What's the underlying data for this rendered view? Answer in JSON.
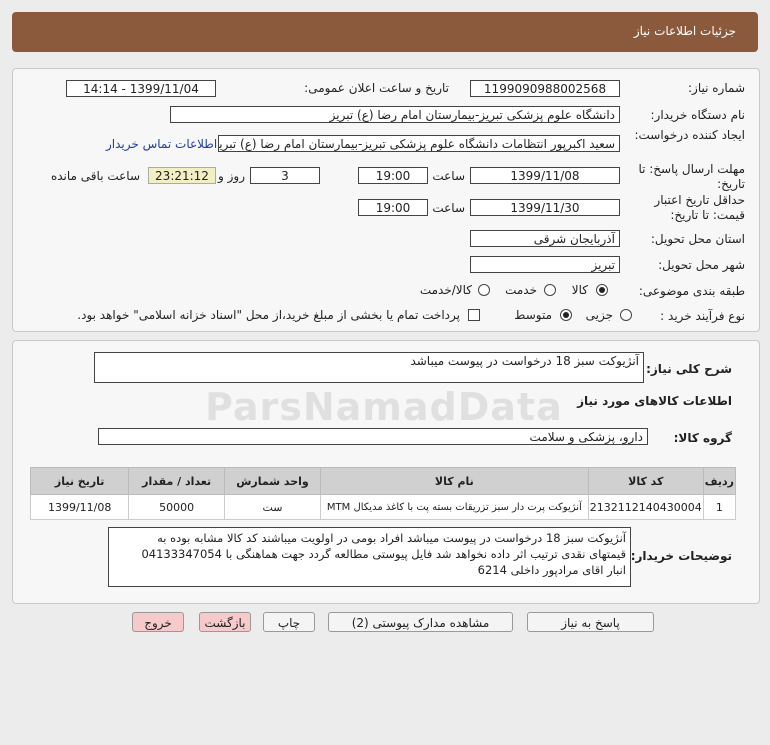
{
  "header": {
    "title": "جزئیات اطلاعات نیاز"
  },
  "fields": {
    "need_number_label": "شماره نیاز:",
    "need_number": "1199090988002568",
    "announce_label": "تاریخ و ساعت اعلان عمومی:",
    "announce_value": "1399/11/04 - 14:14",
    "buyer_label": "نام دستگاه خریدار:",
    "buyer_value": "دانشگاه علوم پزشکی تبریز-بیمارستان امام رضا (ع) تبریز",
    "creator_label": "ایجاد کننده درخواست:",
    "creator_value": "سعید اکبرپور انتظامات دانشگاه علوم پزشکی تبریز-بیمارستان امام رضا (ع) تبریز",
    "contact_link": "اطلاعات تماس خریدار",
    "reply_deadline_label": "مهلت ارسال پاسخ: تا تاریخ:",
    "reply_date": "1399/11/08",
    "time_label": "ساعت",
    "reply_time": "19:00",
    "days_value": "3",
    "days_label": "روز و",
    "remaining_time": "23:21:12",
    "remaining_label": "ساعت باقی مانده",
    "validity_label": "حداقل تاریخ اعتبار قیمت: تا تاریخ:",
    "validity_date": "1399/11/30",
    "validity_time_label": "ساعت",
    "validity_time": "19:00",
    "province_label": "استان محل تحویل:",
    "province_value": "آذربایجان شرقی",
    "city_label": "شهر محل تحویل:",
    "city_value": "تبریز",
    "category_label": "طبقه بندی موضوعی:",
    "category_options": [
      "کالا",
      "خدمت",
      "کالا/خدمت"
    ],
    "category_selected": "کالا",
    "purchase_label": "نوع فرآیند خرید :",
    "purchase_options": [
      "جزیی",
      "متوسط"
    ],
    "purchase_selected": "متوسط",
    "payment_note": "پرداخت تمام یا بخشی از مبلغ خرید،از محل \"اسناد خزانه اسلامی\" خواهد بود."
  },
  "summary": {
    "label": "شرح کلی نیاز:",
    "value": "آنژیوکت سبز 18 درخواست در پیوست میباشد"
  },
  "goods": {
    "section_title": "اطلاعات کالاهای مورد نیاز",
    "group_label": "گروه کالا:",
    "group_value": "دارو، پزشکی و سلامت",
    "columns": [
      "ردیف",
      "کد کالا",
      "نام کالا",
      "واحد شمارش",
      "تعداد / مقدار",
      "تاریخ نیاز"
    ],
    "rows": [
      {
        "row": "1",
        "code": "2132112140430004",
        "name": "آنژیوکت پرت دار سبز تزریقات بسته پت با کاغذ مدیکال MTM",
        "unit": "ست",
        "qty": "50000",
        "date": "1399/11/08"
      }
    ]
  },
  "description": {
    "label": "توضیحات خریدار:",
    "lines": [
      "آنژیوکت سبز 18 درخواست در پیوست میباشد افراد بومی در اولویت میباشند کد کالا مشابه بوده به",
      "قیمتهای نقدی ترتیب اثر داده نخواهد شد فایل پیوستی مطالعه گردد جهت هماهنگی با 04133347054",
      "انبار اقای مرادپور داخلی 6214"
    ]
  },
  "buttons": {
    "reply": "پاسخ به نیاز",
    "attachments": "مشاهده مدارک پیوستی (2)",
    "print": "چاپ",
    "back": "بازگشت",
    "exit": "خروج"
  },
  "watermark": {
    "text": "ParsNamadData"
  }
}
